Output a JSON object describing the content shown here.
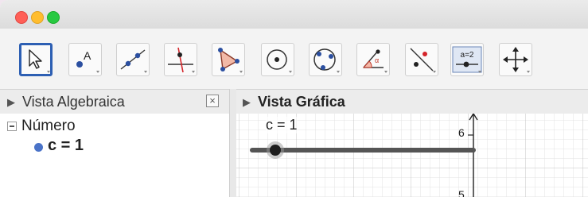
{
  "window": {
    "traffic_lights": [
      "close",
      "minimize",
      "zoom"
    ],
    "colors": {
      "red": "#ff5f57",
      "yellow": "#ffbd2e",
      "green": "#28c941"
    }
  },
  "toolbar": {
    "tools": [
      {
        "name": "move-tool",
        "icon": "cursor-arrow-icon",
        "selected": true
      },
      {
        "name": "point-tool",
        "icon": "point-icon",
        "label": "A"
      },
      {
        "name": "line-tool",
        "icon": "line-through-points-icon"
      },
      {
        "name": "perpendicular-line-tool",
        "icon": "perpendicular-line-icon"
      },
      {
        "name": "polygon-tool",
        "icon": "polygon-icon"
      },
      {
        "name": "circle-tool",
        "icon": "circle-center-point-icon"
      },
      {
        "name": "circle-three-points-tool",
        "icon": "circle-three-points-icon"
      },
      {
        "name": "angle-tool",
        "icon": "angle-icon"
      },
      {
        "name": "reflect-tool",
        "icon": "reflect-about-line-icon"
      },
      {
        "name": "slider-tool",
        "icon": "slider-icon",
        "label": "a=2"
      },
      {
        "name": "move-view-tool",
        "icon": "move-graphics-view-icon"
      }
    ],
    "selected_color": "#2d5fb3"
  },
  "algebra_view": {
    "title": "Vista Algebraica",
    "close_label": "×",
    "group_label": "Número",
    "item": "c = 1",
    "item_color": "#4a73c8"
  },
  "graphics_view": {
    "title": "Vista Gráfica",
    "slider_label": "c = 1",
    "y_ticks": [
      "6",
      "5"
    ]
  }
}
